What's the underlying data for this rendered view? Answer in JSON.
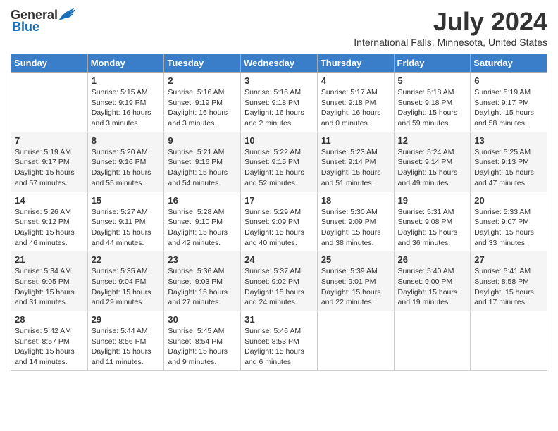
{
  "logo": {
    "general": "General",
    "blue": "Blue"
  },
  "title": "July 2024",
  "location": "International Falls, Minnesota, United States",
  "weekdays": [
    "Sunday",
    "Monday",
    "Tuesday",
    "Wednesday",
    "Thursday",
    "Friday",
    "Saturday"
  ],
  "weeks": [
    [
      {
        "day": "",
        "content": ""
      },
      {
        "day": "1",
        "content": "Sunrise: 5:15 AM\nSunset: 9:19 PM\nDaylight: 16 hours\nand 3 minutes."
      },
      {
        "day": "2",
        "content": "Sunrise: 5:16 AM\nSunset: 9:19 PM\nDaylight: 16 hours\nand 3 minutes."
      },
      {
        "day": "3",
        "content": "Sunrise: 5:16 AM\nSunset: 9:18 PM\nDaylight: 16 hours\nand 2 minutes."
      },
      {
        "day": "4",
        "content": "Sunrise: 5:17 AM\nSunset: 9:18 PM\nDaylight: 16 hours\nand 0 minutes."
      },
      {
        "day": "5",
        "content": "Sunrise: 5:18 AM\nSunset: 9:18 PM\nDaylight: 15 hours\nand 59 minutes."
      },
      {
        "day": "6",
        "content": "Sunrise: 5:19 AM\nSunset: 9:17 PM\nDaylight: 15 hours\nand 58 minutes."
      }
    ],
    [
      {
        "day": "7",
        "content": "Sunrise: 5:19 AM\nSunset: 9:17 PM\nDaylight: 15 hours\nand 57 minutes."
      },
      {
        "day": "8",
        "content": "Sunrise: 5:20 AM\nSunset: 9:16 PM\nDaylight: 15 hours\nand 55 minutes."
      },
      {
        "day": "9",
        "content": "Sunrise: 5:21 AM\nSunset: 9:16 PM\nDaylight: 15 hours\nand 54 minutes."
      },
      {
        "day": "10",
        "content": "Sunrise: 5:22 AM\nSunset: 9:15 PM\nDaylight: 15 hours\nand 52 minutes."
      },
      {
        "day": "11",
        "content": "Sunrise: 5:23 AM\nSunset: 9:14 PM\nDaylight: 15 hours\nand 51 minutes."
      },
      {
        "day": "12",
        "content": "Sunrise: 5:24 AM\nSunset: 9:14 PM\nDaylight: 15 hours\nand 49 minutes."
      },
      {
        "day": "13",
        "content": "Sunrise: 5:25 AM\nSunset: 9:13 PM\nDaylight: 15 hours\nand 47 minutes."
      }
    ],
    [
      {
        "day": "14",
        "content": "Sunrise: 5:26 AM\nSunset: 9:12 PM\nDaylight: 15 hours\nand 46 minutes."
      },
      {
        "day": "15",
        "content": "Sunrise: 5:27 AM\nSunset: 9:11 PM\nDaylight: 15 hours\nand 44 minutes."
      },
      {
        "day": "16",
        "content": "Sunrise: 5:28 AM\nSunset: 9:10 PM\nDaylight: 15 hours\nand 42 minutes."
      },
      {
        "day": "17",
        "content": "Sunrise: 5:29 AM\nSunset: 9:09 PM\nDaylight: 15 hours\nand 40 minutes."
      },
      {
        "day": "18",
        "content": "Sunrise: 5:30 AM\nSunset: 9:09 PM\nDaylight: 15 hours\nand 38 minutes."
      },
      {
        "day": "19",
        "content": "Sunrise: 5:31 AM\nSunset: 9:08 PM\nDaylight: 15 hours\nand 36 minutes."
      },
      {
        "day": "20",
        "content": "Sunrise: 5:33 AM\nSunset: 9:07 PM\nDaylight: 15 hours\nand 33 minutes."
      }
    ],
    [
      {
        "day": "21",
        "content": "Sunrise: 5:34 AM\nSunset: 9:05 PM\nDaylight: 15 hours\nand 31 minutes."
      },
      {
        "day": "22",
        "content": "Sunrise: 5:35 AM\nSunset: 9:04 PM\nDaylight: 15 hours\nand 29 minutes."
      },
      {
        "day": "23",
        "content": "Sunrise: 5:36 AM\nSunset: 9:03 PM\nDaylight: 15 hours\nand 27 minutes."
      },
      {
        "day": "24",
        "content": "Sunrise: 5:37 AM\nSunset: 9:02 PM\nDaylight: 15 hours\nand 24 minutes."
      },
      {
        "day": "25",
        "content": "Sunrise: 5:39 AM\nSunset: 9:01 PM\nDaylight: 15 hours\nand 22 minutes."
      },
      {
        "day": "26",
        "content": "Sunrise: 5:40 AM\nSunset: 9:00 PM\nDaylight: 15 hours\nand 19 minutes."
      },
      {
        "day": "27",
        "content": "Sunrise: 5:41 AM\nSunset: 8:58 PM\nDaylight: 15 hours\nand 17 minutes."
      }
    ],
    [
      {
        "day": "28",
        "content": "Sunrise: 5:42 AM\nSunset: 8:57 PM\nDaylight: 15 hours\nand 14 minutes."
      },
      {
        "day": "29",
        "content": "Sunrise: 5:44 AM\nSunset: 8:56 PM\nDaylight: 15 hours\nand 11 minutes."
      },
      {
        "day": "30",
        "content": "Sunrise: 5:45 AM\nSunset: 8:54 PM\nDaylight: 15 hours\nand 9 minutes."
      },
      {
        "day": "31",
        "content": "Sunrise: 5:46 AM\nSunset: 8:53 PM\nDaylight: 15 hours\nand 6 minutes."
      },
      {
        "day": "",
        "content": ""
      },
      {
        "day": "",
        "content": ""
      },
      {
        "day": "",
        "content": ""
      }
    ]
  ]
}
